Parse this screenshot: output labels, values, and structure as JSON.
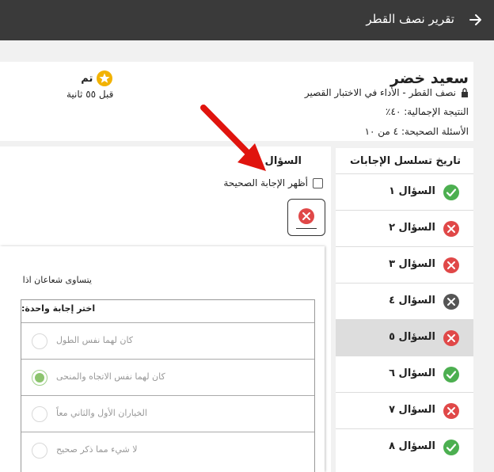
{
  "header": {
    "title": "تقرير نصف القطر",
    "back_icon": "arrow-right-icon"
  },
  "student": {
    "name": "سعيد خضر",
    "quiz": "نصف القطر - الأداء في الاختبار القصير",
    "score": "النتيجة الإجمالية: ٤٠٪",
    "correct": "الأسئلة الصحيحة: ٤ من ١٠",
    "status_label": "تم",
    "status_time": "قبل ٥٥ ثانية"
  },
  "question": {
    "title": "السؤال ٥",
    "show_answer_label": "أظهر الإجابة الصحيحة",
    "show_answer_checked": false,
    "result": "incorrect",
    "stem": "يتساوى شعاعان اذا",
    "choices_header": "اختر إجابة واحدة:",
    "choices": [
      {
        "label": "كان لهما نفس الطول",
        "selected": false
      },
      {
        "label": "كان لهما نفس الاتجاه والمنحى",
        "selected": true
      },
      {
        "label": "الخياران الأول والثاني معاً",
        "selected": false
      },
      {
        "label": "لا شيء مما ذكر صحيح",
        "selected": false
      }
    ]
  },
  "sequence": {
    "title": "تاريخ تسلسل الإجابات",
    "active_index": 4,
    "items": [
      {
        "label": "السؤال ١",
        "status": "correct"
      },
      {
        "label": "السؤال ٢",
        "status": "incorrect"
      },
      {
        "label": "السؤال ٣",
        "status": "incorrect"
      },
      {
        "label": "السؤال ٤",
        "status": "unanswered"
      },
      {
        "label": "السؤال ٥",
        "status": "incorrect"
      },
      {
        "label": "السؤال ٦",
        "status": "correct"
      },
      {
        "label": "السؤال ٧",
        "status": "incorrect"
      },
      {
        "label": "السؤال ٨",
        "status": "correct"
      }
    ]
  },
  "colors": {
    "correct": "#4caf50",
    "incorrect": "#e04848",
    "unanswered": "#555555",
    "topbar": "#3a3a3a",
    "annotation": "#e0140e",
    "star": "#f2b200"
  }
}
